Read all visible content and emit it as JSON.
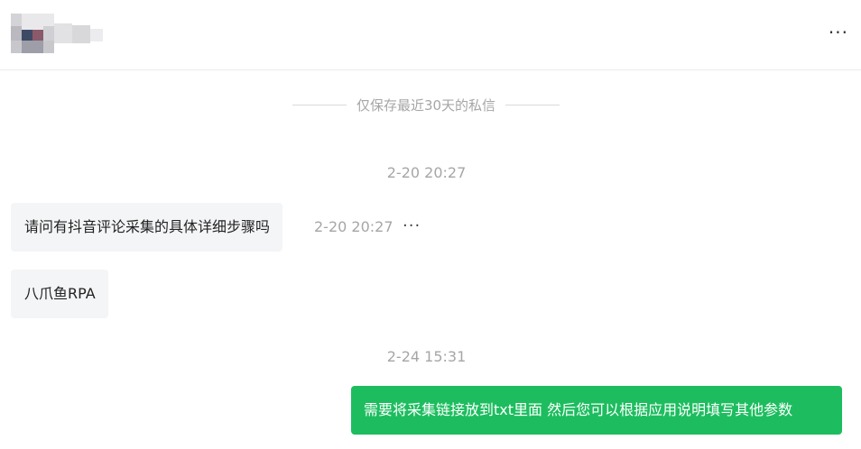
{
  "header": {
    "more_label": "···"
  },
  "notice": {
    "text": "仅保存最近30天的私信"
  },
  "messages": [
    {
      "timestamp": "2-20 20:27"
    },
    {
      "text": "请问有抖音评论采集的具体详细步骤吗",
      "time": "2-20 20:27",
      "more": "···"
    },
    {
      "text": "八爪鱼RPA"
    },
    {
      "timestamp": "2-24 15:31"
    },
    {
      "text": "需要将采集链接放到txt里面 然后您可以根据应用说明填写其他参数"
    }
  ],
  "colors": {
    "outgoing_bubble": "#1dbd5f",
    "incoming_bubble": "#f4f5f7",
    "muted_text": "#a6a6a6"
  }
}
